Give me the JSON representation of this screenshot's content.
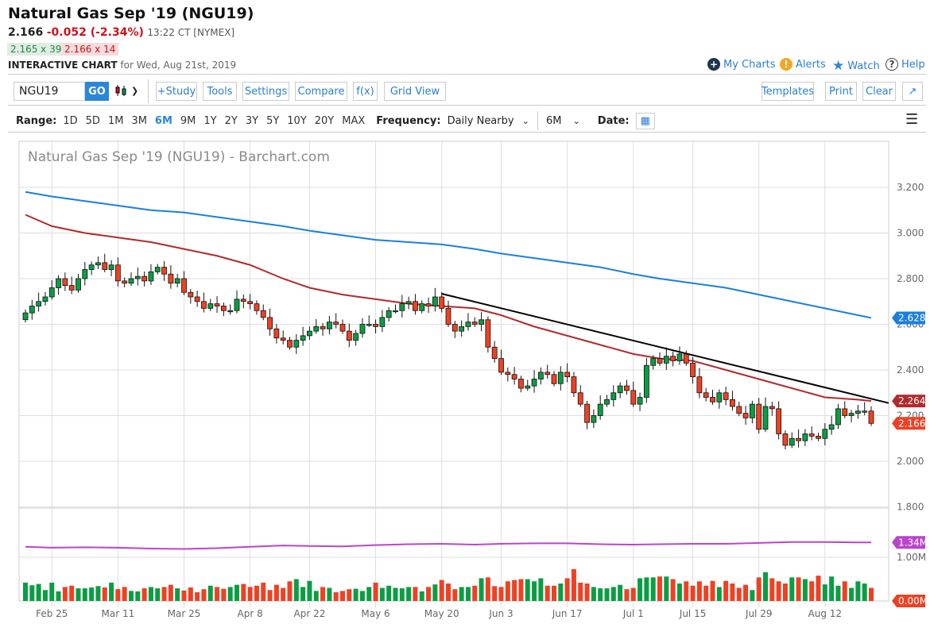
{
  "header": {
    "title": "Natural Gas Sep '19 (NGU19)",
    "last": "2.166",
    "change": "-0.052 (-2.34%)",
    "time": "13:22 CT [NYMEX]",
    "bid": "2.165 x 39",
    "ask": "2.166 x 14",
    "chart_label": "INTERACTIVE CHART",
    "chart_date": "for Wed, Aug 21st, 2019"
  },
  "topnav": {
    "my_charts": "My Charts",
    "alerts": "Alerts",
    "watch": "Watch",
    "help": "Help"
  },
  "toolbar": {
    "symbol": "NGU19",
    "go": "GO",
    "study": "+Study",
    "tools": "Tools",
    "settings": "Settings",
    "compare": "Compare",
    "fx": "f(x)",
    "grid": "Grid View",
    "templates": "Templates",
    "print": "Print",
    "clear": "Clear",
    "expand": "↗"
  },
  "rangebar": {
    "range_label": "Range:",
    "ranges": [
      "1D",
      "5D",
      "1M",
      "3M",
      "6M",
      "9M",
      "1Y",
      "2Y",
      "3Y",
      "5Y",
      "10Y",
      "20Y",
      "MAX"
    ],
    "active": "6M",
    "frequency_label": "Frequency:",
    "frequency": "Daily Nearby",
    "period": "6M",
    "date_label": "Date:"
  },
  "colors": {
    "up": "#0a9e44",
    "down": "#ee4123",
    "ma50": "#b22a2e",
    "ma200": "#1a7fe0",
    "trend": "#000000",
    "vol_avg": "#bb44cc"
  },
  "chart_data": {
    "type": "candlestick",
    "title": "Natural Gas Sep '19 (NGU19) - Barchart.com",
    "ylim": [
      1.8,
      3.3
    ],
    "y_ticks": [
      "1.800",
      "2.000",
      "2.200",
      "2.400",
      "2.600",
      "2.800",
      "3.000",
      "3.200"
    ],
    "x_ticks": [
      "Feb 25",
      "Mar 11",
      "Mar 25",
      "Apr 8",
      "Apr 22",
      "May 6",
      "May 20",
      "Jun 3",
      "Jun 17",
      "Jul 1",
      "Jul 15",
      "Jul 29",
      "Aug 12"
    ],
    "weeks": [
      {
        "week": "Feb 19",
        "close": [
          2.65,
          2.68,
          2.7,
          2.72
        ],
        "vol": [
          0.42,
          0.36,
          0.39,
          0.25
        ]
      },
      {
        "week": "Feb 25",
        "close": [
          2.76,
          2.8,
          2.77,
          2.75,
          2.8
        ],
        "vol": [
          0.42,
          0.22,
          0.32,
          0.35,
          0.29
        ]
      },
      {
        "week": "Mar 4",
        "close": [
          2.84,
          2.86,
          2.87,
          2.84,
          2.86
        ],
        "vol": [
          0.29,
          0.31,
          0.34,
          0.31,
          0.42
        ]
      },
      {
        "week": "Mar 11",
        "close": [
          2.79,
          2.78,
          2.8,
          2.81,
          2.79
        ],
        "vol": [
          0.27,
          0.32,
          0.23,
          0.22,
          0.29
        ]
      },
      {
        "week": "Mar 18",
        "close": [
          2.83,
          2.85,
          2.82,
          2.78,
          2.8
        ],
        "vol": [
          0.32,
          0.29,
          0.32,
          0.37,
          0.29
        ]
      },
      {
        "week": "Mar 25",
        "close": [
          2.74,
          2.72,
          2.7,
          2.67,
          2.69
        ],
        "vol": [
          0.24,
          0.31,
          0.2,
          0.27,
          0.35
        ]
      },
      {
        "week": "Apr 1",
        "close": [
          2.68,
          2.66,
          2.66,
          2.71,
          2.7
        ],
        "vol": [
          0.32,
          0.28,
          0.32,
          0.37,
          0.39
        ]
      },
      {
        "week": "Apr 8",
        "close": [
          2.69,
          2.66,
          2.63,
          2.58,
          2.54
        ],
        "vol": [
          0.32,
          0.35,
          0.42,
          0.25,
          0.37
        ]
      },
      {
        "week": "Apr 15",
        "close": [
          2.53,
          2.5,
          2.53,
          2.55
        ],
        "vol": [
          0.3,
          0.45,
          0.5,
          0.32
        ]
      },
      {
        "week": "Apr 22",
        "close": [
          2.57,
          2.59,
          2.58,
          2.61,
          2.6
        ],
        "vol": [
          0.46,
          0.23,
          0.32,
          0.3,
          0.2
        ]
      },
      {
        "week": "Apr 29",
        "close": [
          2.57,
          2.53,
          2.56,
          2.6,
          2.6
        ],
        "vol": [
          0.23,
          0.27,
          0.28,
          0.23,
          0.32
        ]
      },
      {
        "week": "May 6",
        "close": [
          2.59,
          2.63,
          2.66,
          2.66,
          2.69
        ],
        "vol": [
          0.42,
          0.3,
          0.35,
          0.3,
          0.29
        ]
      },
      {
        "week": "May 13",
        "close": [
          2.7,
          2.66,
          2.69,
          2.68,
          2.72
        ],
        "vol": [
          0.32,
          0.32,
          0.22,
          0.32,
          0.38
        ]
      },
      {
        "week": "May 20",
        "close": [
          2.67,
          2.6,
          2.57,
          2.59,
          2.61
        ],
        "vol": [
          0.48,
          0.4,
          0.27,
          0.32,
          0.32
        ]
      },
      {
        "week": "May 27",
        "close": [
          2.6,
          2.62,
          2.5,
          2.45
        ],
        "vol": [
          0.35,
          0.52,
          0.54,
          0.34
        ]
      },
      {
        "week": "Jun 3",
        "close": [
          2.39,
          2.38,
          2.36,
          2.32,
          2.33
        ],
        "vol": [
          0.32,
          0.45,
          0.48,
          0.5,
          0.5
        ]
      },
      {
        "week": "Jun 10",
        "close": [
          2.36,
          2.39,
          2.38,
          2.34,
          2.39
        ],
        "vol": [
          0.45,
          0.52,
          0.35,
          0.35,
          0.4
        ]
      },
      {
        "week": "Jun 17",
        "close": [
          2.37,
          2.3,
          2.25,
          2.17,
          2.2
        ],
        "vol": [
          0.52,
          0.73,
          0.42,
          0.4,
          0.32
        ]
      },
      {
        "week": "Jun 24",
        "close": [
          2.25,
          2.27,
          2.3,
          2.33,
          2.31
        ],
        "vol": [
          0.29,
          0.29,
          0.32,
          0.37,
          0.27
        ]
      },
      {
        "week": "Jul 1",
        "close": [
          2.25,
          2.28,
          2.42,
          2.45
        ],
        "vol": [
          0.3,
          0.52,
          0.54,
          0.54
        ]
      },
      {
        "week": "Jul 8",
        "close": [
          2.43,
          2.46,
          2.44,
          2.47,
          2.43
        ],
        "vol": [
          0.56,
          0.56,
          0.5,
          0.4,
          0.45
        ]
      },
      {
        "week": "Jul 15",
        "close": [
          2.37,
          2.3,
          2.28,
          2.26,
          2.3
        ],
        "vol": [
          0.35,
          0.45,
          0.35,
          0.46,
          0.32
        ]
      },
      {
        "week": "Jul 22",
        "close": [
          2.27,
          2.24,
          2.21,
          2.19,
          2.25
        ],
        "vol": [
          0.46,
          0.4,
          0.3,
          0.37,
          0.25
        ]
      },
      {
        "week": "Jul 29",
        "close": [
          2.14,
          2.24,
          2.23,
          2.12,
          2.07
        ],
        "vol": [
          0.54,
          0.66,
          0.52,
          0.45,
          0.4
        ]
      },
      {
        "week": "Aug 5",
        "close": [
          2.1,
          2.09,
          2.12,
          2.11,
          2.1
        ],
        "vol": [
          0.54,
          0.54,
          0.5,
          0.45,
          0.58
        ]
      },
      {
        "week": "Aug 12",
        "close": [
          2.14,
          2.16,
          2.23,
          2.2,
          2.21
        ],
        "vol": [
          0.38,
          0.56,
          0.35,
          0.45,
          0.3
        ]
      },
      {
        "week": "Aug 19",
        "close": [
          2.22,
          2.22,
          2.166
        ],
        "vol": [
          0.45,
          0.4,
          0.3
        ]
      }
    ],
    "ma50": [
      3.08,
      3.03,
      3.0,
      2.98,
      2.96,
      2.93,
      2.9,
      2.86,
      2.8,
      2.76,
      2.73,
      2.71,
      2.69,
      2.68,
      2.67,
      2.64,
      2.59,
      2.55,
      2.51,
      2.47,
      2.45,
      2.44,
      2.4,
      2.36,
      2.32,
      2.28,
      2.27,
      2.264
    ],
    "ma200": [
      3.18,
      3.16,
      3.14,
      3.12,
      3.1,
      3.09,
      3.07,
      3.05,
      3.03,
      3.01,
      2.99,
      2.97,
      2.96,
      2.95,
      2.93,
      2.91,
      2.89,
      2.87,
      2.85,
      2.82,
      2.8,
      2.78,
      2.76,
      2.73,
      2.7,
      2.67,
      2.64,
      2.628
    ],
    "trendline": {
      "from": {
        "date": "May 20",
        "price": 2.734
      },
      "to": {
        "date": "Aug 21",
        "price": 2.255
      }
    },
    "last_labels": {
      "ma200": "2.628",
      "ma50": "2.264",
      "last": "2.166"
    },
    "volume": {
      "ticks": [
        "1.00M"
      ],
      "avg": [
        1.24,
        1.22,
        1.23,
        1.22,
        1.2,
        1.19,
        1.21,
        1.24,
        1.27,
        1.26,
        1.25,
        1.28,
        1.3,
        1.31,
        1.29,
        1.31,
        1.32,
        1.32,
        1.3,
        1.29,
        1.3,
        1.31,
        1.31,
        1.33,
        1.35,
        1.35,
        1.34,
        1.34
      ],
      "avg_label": "1.34M",
      "last_label": "0.00M"
    }
  }
}
